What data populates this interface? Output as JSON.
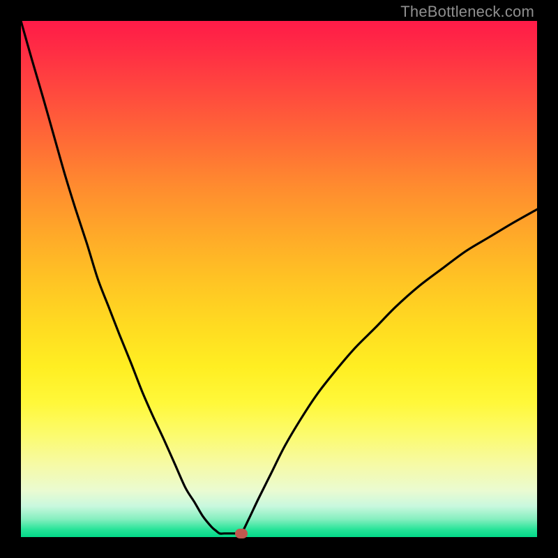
{
  "watermark": "TheBottleneck.com",
  "colors": {
    "curve_stroke": "#000000",
    "marker_fill": "#c0584f",
    "frame_bg": "#000000"
  },
  "chart_data": {
    "type": "line",
    "title": "",
    "xlabel": "",
    "ylabel": "",
    "xlim": [
      0,
      100
    ],
    "ylim": [
      0,
      100
    ],
    "grid": false,
    "legend": false,
    "series": [
      {
        "name": "left-branch",
        "x": [
          0.0,
          2.1,
          4.3,
          6.4,
          8.5,
          10.6,
          12.8,
          14.9,
          17.0,
          19.1,
          21.3,
          23.4,
          25.5,
          27.7,
          29.8,
          31.9,
          33.6,
          35.2,
          36.9,
          37.7,
          38.5
        ],
        "y": [
          100.0,
          92.6,
          85.1,
          77.7,
          70.3,
          63.5,
          56.8,
          50.0,
          44.6,
          39.2,
          33.8,
          28.4,
          23.6,
          18.9,
          14.2,
          9.5,
          6.8,
          4.1,
          2.0,
          1.3,
          0.7
        ]
      },
      {
        "name": "valley-floor",
        "x": [
          38.5,
          39.4,
          40.2,
          41.0,
          41.9,
          42.7
        ],
        "y": [
          0.7,
          0.7,
          0.7,
          0.7,
          0.7,
          0.7
        ]
      },
      {
        "name": "right-branch",
        "x": [
          42.7,
          44.1,
          46.0,
          48.4,
          51.1,
          54.3,
          57.4,
          60.6,
          64.6,
          68.6,
          72.6,
          77.1,
          81.6,
          86.2,
          90.7,
          95.2,
          100.0
        ],
        "y": [
          0.7,
          3.4,
          7.4,
          12.2,
          17.6,
          23.0,
          27.7,
          31.8,
          36.5,
          40.5,
          44.6,
          48.6,
          52.0,
          55.4,
          58.1,
          60.8,
          63.5
        ]
      }
    ],
    "marker": {
      "x": 42.7,
      "y": 0.7
    }
  }
}
